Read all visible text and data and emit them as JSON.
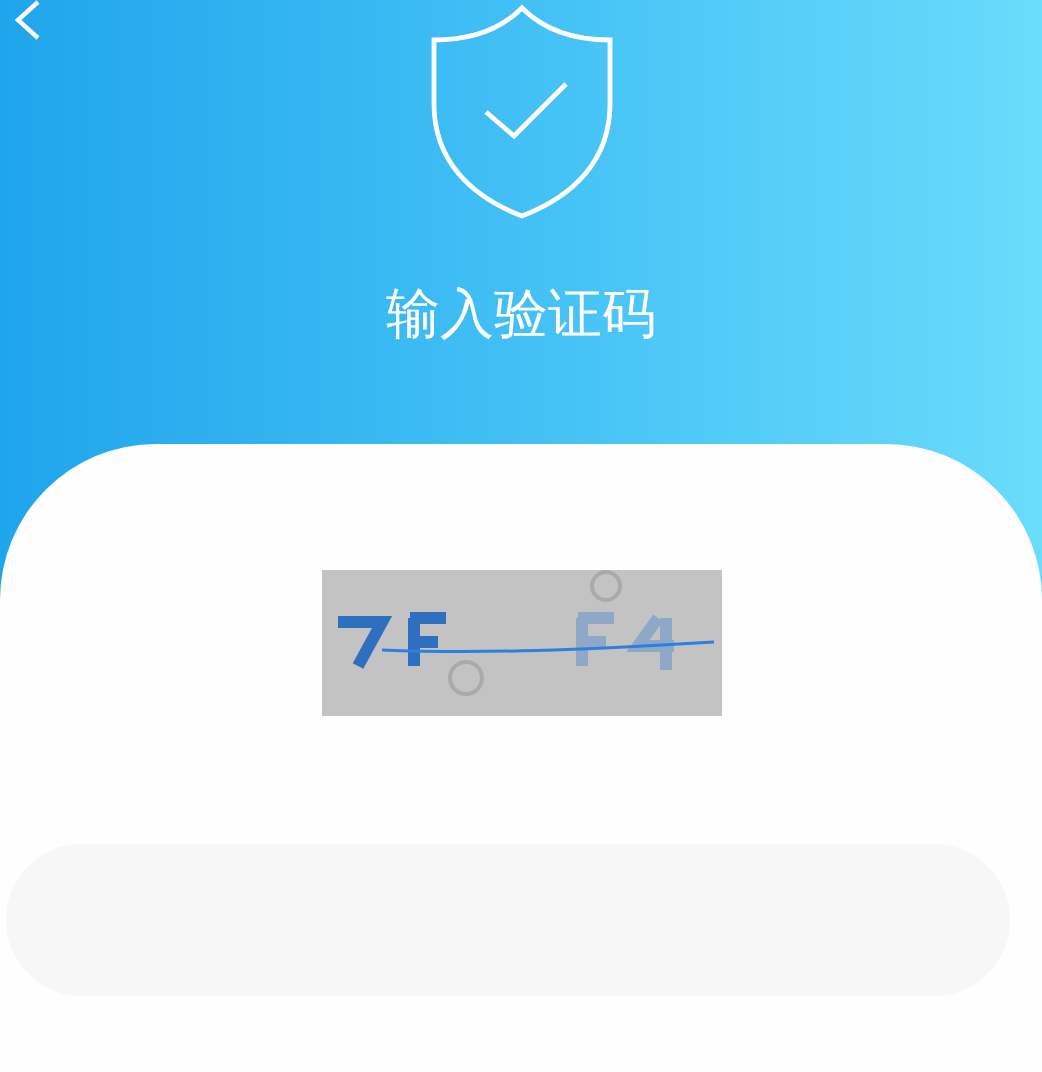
{
  "header": {
    "title": "输入验证码"
  }
}
